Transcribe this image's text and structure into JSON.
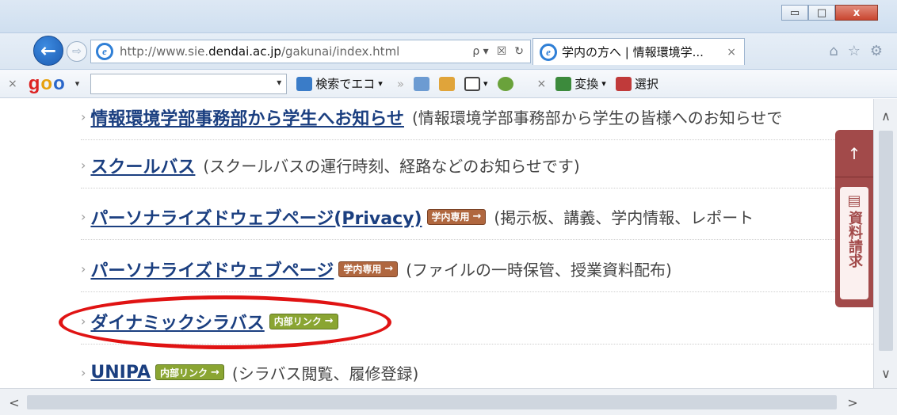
{
  "window": {
    "minimize_glyph": "▭",
    "maximize_glyph": "□",
    "close_glyph": "x"
  },
  "nav": {
    "back_glyph": "←",
    "forward_glyph": "⇨",
    "url_prefix": "http://www.sie.",
    "url_domain": "dendai.ac.jp",
    "url_path": "/gakunai/index.html",
    "search_glyph": "ρ ▾",
    "compat_glyph": "☒",
    "refresh_glyph": "↻",
    "tab_title": "学内の方へ | 情報環境学...",
    "tab_close": "×",
    "home_glyph": "⌂",
    "favorites_glyph": "☆",
    "settings_glyph": "⚙"
  },
  "toolbar": {
    "close_glyph": "×",
    "logo": {
      "g": "g",
      "o1": "o",
      "o2": "o"
    },
    "search_button_label": "検索でエコ",
    "caret": "▾",
    "chevrons": "»",
    "convert_label": "変換",
    "select_label": "選択",
    "icon_colors": {
      "search": "#3a7cc8",
      "tool1": "#6c9bd2",
      "tool2": "#e0a43a",
      "tool3": "#444444",
      "tool4": "#6aa23b",
      "convert": "#3c8a3c",
      "select": "#c03a3a"
    }
  },
  "content": {
    "rows": [
      {
        "link": "情報環境学部事務部から学生へお知らせ",
        "desc": "(情報環境学部事務部から学生の皆様へのお知らせで",
        "badge": null
      },
      {
        "link": "スクールバス",
        "desc": "(スクールバスの運行時刻、経路などのお知らせです)",
        "badge": null
      },
      {
        "link": "パーソナライズドウェブページ(Privacy)",
        "desc": "(掲示板、講義、学内情報、レポート",
        "badge": {
          "type": "gak",
          "label": "学内専用"
        }
      },
      {
        "link": "パーソナライズドウェブページ",
        "desc": "(ファイルの一時保管、授業資料配布)",
        "badge": {
          "type": "gak",
          "label": "学内専用"
        }
      },
      {
        "link": "ダイナミックシラバス",
        "desc": "",
        "badge": {
          "type": "nai",
          "label": "内部リンク"
        }
      },
      {
        "link": "UNIPA",
        "desc": "(シラバス閲覧、履修登録)",
        "badge": {
          "type": "nai",
          "label": "内部リンク"
        }
      }
    ],
    "arrow_glyph": "›",
    "badge_arrow": "→"
  },
  "side_widget": {
    "top_glyph": "↑",
    "label": "資料請求",
    "doc_glyph": "▤"
  },
  "scroll": {
    "up": "∧",
    "down": "∨",
    "left": "<",
    "right": ">"
  }
}
